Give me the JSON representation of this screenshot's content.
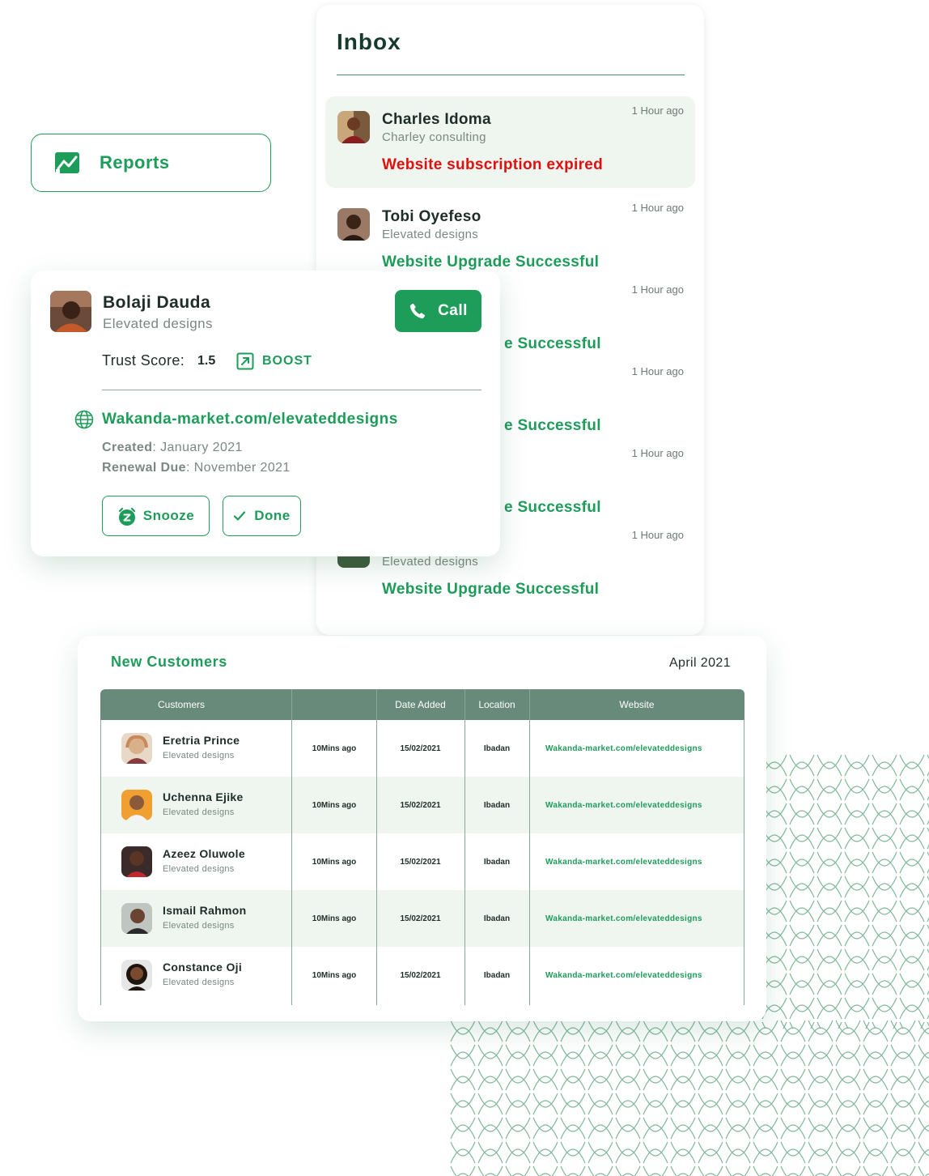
{
  "reports": {
    "label": "Reports",
    "icon": "chart-trend-icon"
  },
  "inbox": {
    "title": "Inbox",
    "messages": [
      {
        "name": "Charles Idoma",
        "company": "Charley consulting",
        "time": "1 Hour ago",
        "status": "Website subscription expired",
        "status_type": "error",
        "highlighted": true
      },
      {
        "name": "Tobi Oyefeso",
        "company": "Elevated designs",
        "time": "1 Hour ago",
        "status": "Website Upgrade Successful",
        "status_type": "success",
        "highlighted": false
      },
      {
        "name": "",
        "company": "",
        "time": "1 Hour ago",
        "status": "e Successful",
        "status_type": "success",
        "highlighted": false
      },
      {
        "name": "",
        "company": "",
        "time": "1 Hour ago",
        "status": "e Successful",
        "status_type": "success",
        "highlighted": false
      },
      {
        "name": "",
        "company": "",
        "time": "1 Hour ago",
        "status": "e Successful",
        "status_type": "success",
        "highlighted": false
      },
      {
        "name": "",
        "company": "Elevated designs",
        "time": "1 Hour ago",
        "status": "Website Upgrade Successful",
        "status_type": "success",
        "highlighted": false
      }
    ]
  },
  "profile": {
    "name": "Bolaji Dauda",
    "company": "Elevated designs",
    "call_label": "Call",
    "trust_label": "Trust Score:",
    "trust_value": "1.5",
    "boost_label": "BOOST",
    "website": "Wakanda-market.com/elevateddesigns",
    "created_key": "Created",
    "created_value": ": January 2021",
    "renewal_key": "Renewal Due",
    "renewal_value": ": November 2021",
    "snooze_label": "Snooze",
    "done_label": "Done"
  },
  "customers": {
    "title": "New Customers",
    "period": "April 2021",
    "columns": [
      "Customers",
      "",
      "Date Added",
      "Location",
      "Website"
    ],
    "rows": [
      {
        "name": "Eretria Prince",
        "company": "Elevated designs",
        "added": "10Mins ago",
        "date": "15/02/2021",
        "location": "Ibadan",
        "website": "Wakanda-market.com/elevateddesigns"
      },
      {
        "name": "Uchenna Ejike",
        "company": "Elevated designs",
        "added": "10Mins ago",
        "date": "15/02/2021",
        "location": "Ibadan",
        "website": "Wakanda-market.com/elevateddesigns"
      },
      {
        "name": "Azeez Oluwole",
        "company": "Elevated designs",
        "added": "10Mins ago",
        "date": "15/02/2021",
        "location": "Ibadan",
        "website": "Wakanda-market.com/elevateddesigns"
      },
      {
        "name": "Ismail Rahmon",
        "company": "Elevated designs",
        "added": "10Mins ago",
        "date": "15/02/2021",
        "location": "Ibadan",
        "website": "Wakanda-market.com/elevateddesigns"
      },
      {
        "name": "Constance Oji",
        "company": "Elevated designs",
        "added": "10Mins ago",
        "date": "15/02/2021",
        "location": "Ibadan",
        "website": "Wakanda-market.com/elevateddesigns"
      }
    ]
  },
  "colors": {
    "accent": "#1e9c5a",
    "error": "#e01010",
    "table_header": "#678a7b",
    "row_alt": "#eef6ef"
  }
}
